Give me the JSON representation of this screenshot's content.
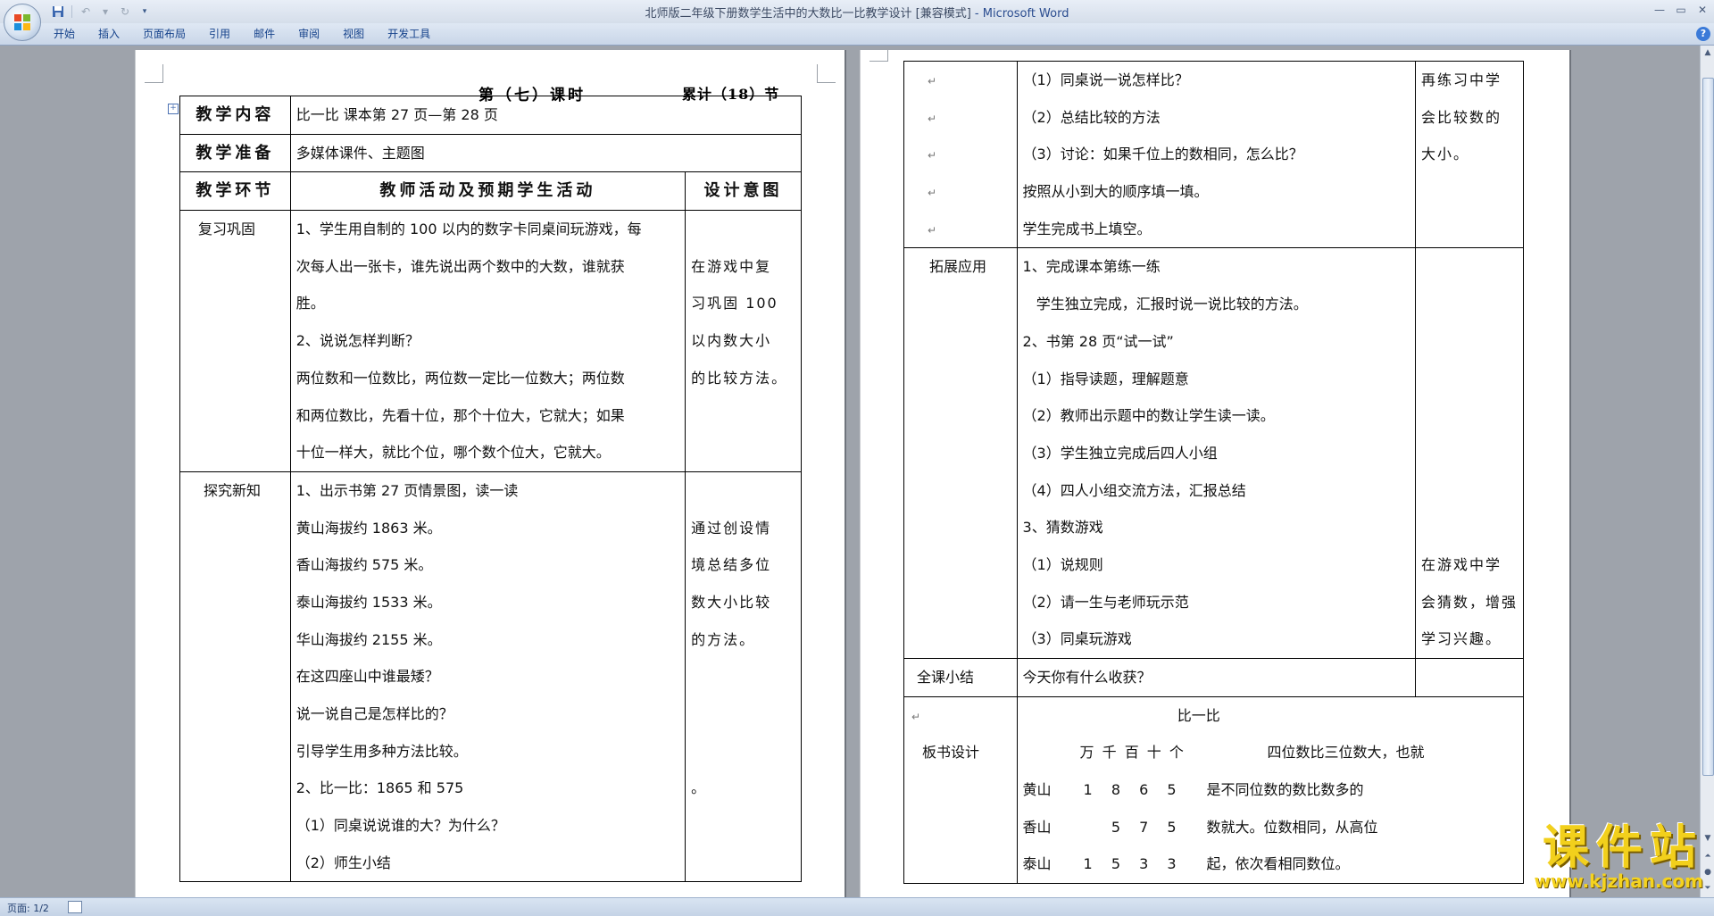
{
  "window": {
    "title": "北师版二年级下册数学生活中的大数比一比教学设计 [兼容模式]",
    "app_suffix": " - Microsoft Word"
  },
  "qat": {
    "save_icon": "save-icon",
    "undo_icon": "undo-icon",
    "redo_icon": "redo-icon",
    "customize_icon": "qat-dropdown-icon"
  },
  "ribbon": {
    "tabs": [
      "开始",
      "插入",
      "页面布局",
      "引用",
      "邮件",
      "审阅",
      "视图",
      "开发工具"
    ]
  },
  "doc": {
    "header_title": "第（七）课时",
    "header_count": "累计（18）节",
    "left_table": {
      "content_label": "教学内容",
      "content_value": "比一比 课本第 27 页—第 28 页",
      "prep_label": "教学准备",
      "prep_value": "多媒体课件、主题图",
      "col_stage": "教学环节",
      "col_activity": "教师活动及预期学生活动",
      "col_intent": "设计意图",
      "review_stage": "复习巩固",
      "review_lines": [
        "1、学生用自制的 100 以内的数字卡同桌间玩游戏，每",
        "次每人出一张卡，谁先说出两个数中的大数，谁就获",
        "胜。",
        "2、说说怎样判断？",
        "两位数和一位数比，两位数一定比一位数大；两位数",
        "和两位数比，先看十位，那个十位大，它就大；如果",
        "十位一样大，就比个位，哪个数个位大，它就大。"
      ],
      "review_intent": [
        "",
        "在游戏中复",
        "习巩固 100",
        "以内数大小",
        "的比较方法。",
        "",
        ""
      ],
      "explore_stage": "探究新知",
      "explore_lines": [
        "1、出示书第 27 页情景图，读一读",
        "黄山海拔约 1863 米。",
        "香山海拔约 575 米。",
        "泰山海拔约 1533 米。",
        "华山海拔约 2155 米。",
        "在这四座山中谁最矮？",
        "说一说自己是怎样比的？",
        "引导学生用多种方法比较。",
        "2、比一比：1865 和 575",
        "（1）同桌说说谁的大？为什么？",
        "（2）师生小结"
      ],
      "explore_intent": [
        "",
        "通过创设情",
        "境总结多位",
        "数大小比较",
        "的方法。",
        "",
        "",
        "",
        "。",
        "",
        ""
      ]
    },
    "right_table": {
      "continue_lines": [
        "（1）同桌说一说怎样比？",
        "（2）总结比较的方法",
        "（3）讨论：如果千位上的数相同，怎么比？",
        "按照从小到大的顺序填一填。",
        "学生完成书上填空。"
      ],
      "continue_intent": [
        "再练习中学",
        "会比较数的",
        "大小。",
        "",
        ""
      ],
      "extend_stage": "拓展应用",
      "extend_lines": [
        "1、完成课本第练一练",
        "   学生独立完成，汇报时说一说比较的方法。",
        "2、书第 28 页“试一试”",
        "（1）指导读题，理解题意",
        "（2）教师出示题中的数让学生读一读。",
        "（3）学生独立完成后四人小组",
        "（4）四人小组交流方法，汇报总结",
        "3、猜数游戏",
        "（1）说规则",
        "（2）请一生与老师玩示范",
        "（3）同桌玩游戏"
      ],
      "extend_intent": [
        "",
        "",
        "",
        "",
        "",
        "",
        "",
        "",
        "在游戏中学",
        "会猜数，增强",
        "学习兴趣。"
      ],
      "summary_stage": "全课小结",
      "summary_value": "今天你有什么收获？",
      "board_stage": "板书设计",
      "board_title": "比一比",
      "board_header": "万 千 百 十 个",
      "board_rows": [
        {
          "name": "黄山",
          "digits": "1 8 6 5"
        },
        {
          "name": "香山",
          "digits": "5 7 5"
        },
        {
          "name": "泰山",
          "digits": "1 5 3 3"
        }
      ],
      "board_notes": [
        "四位数比三位数大，也就",
        "是不同位数的数比数多的",
        "数就大。位数相同，从高位",
        "起，依次看相同数位。"
      ]
    }
  },
  "status": {
    "page": "页面: 1/2"
  },
  "watermark": {
    "title": "课件站",
    "url": "www.kjzhan.com"
  }
}
